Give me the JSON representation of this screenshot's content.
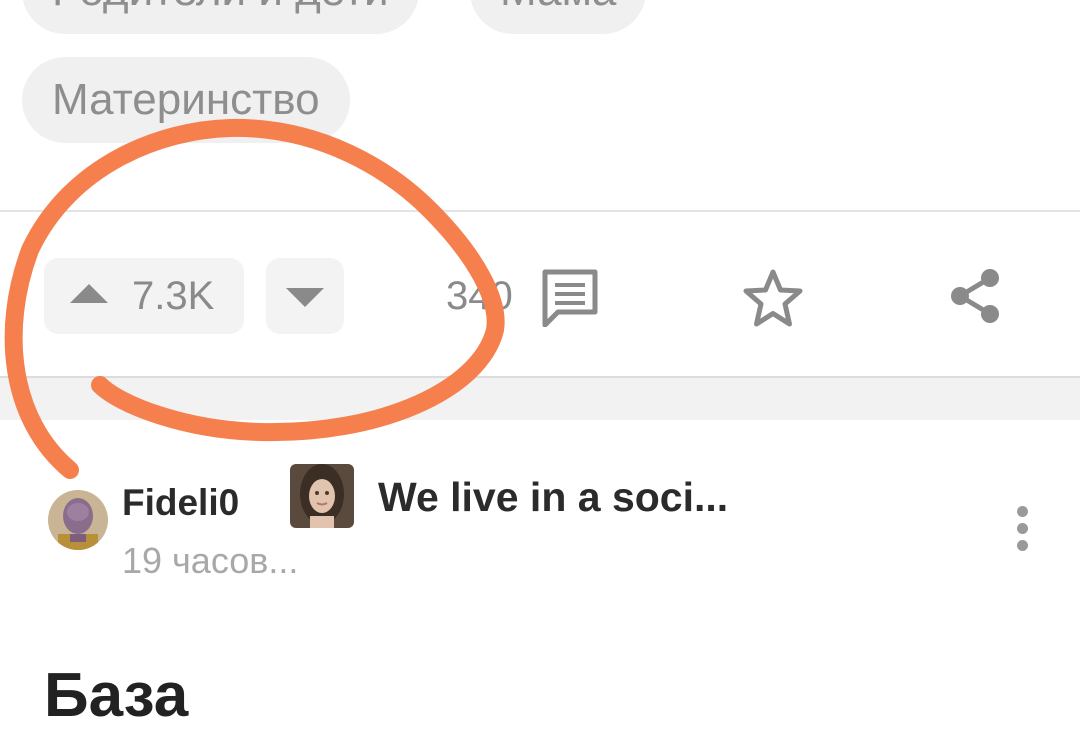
{
  "tags": [
    "Родители и дети",
    "Мама",
    "Материнство"
  ],
  "post_actions": {
    "upvote_count": "7.3K",
    "comment_count": "340",
    "icons": {
      "upvote": "triangle-up-icon",
      "downvote": "triangle-down-icon",
      "comment": "comment-icon",
      "favorite": "star-outline-icon",
      "share": "share-icon"
    }
  },
  "next_post": {
    "author": "Fideli0",
    "time": "19 часов...",
    "community": "We live in a soci...",
    "title": "База"
  },
  "colors": {
    "annotation": "#f5804e",
    "tag_bg": "#f0f0f0",
    "muted_text": "#8a8a8a"
  }
}
